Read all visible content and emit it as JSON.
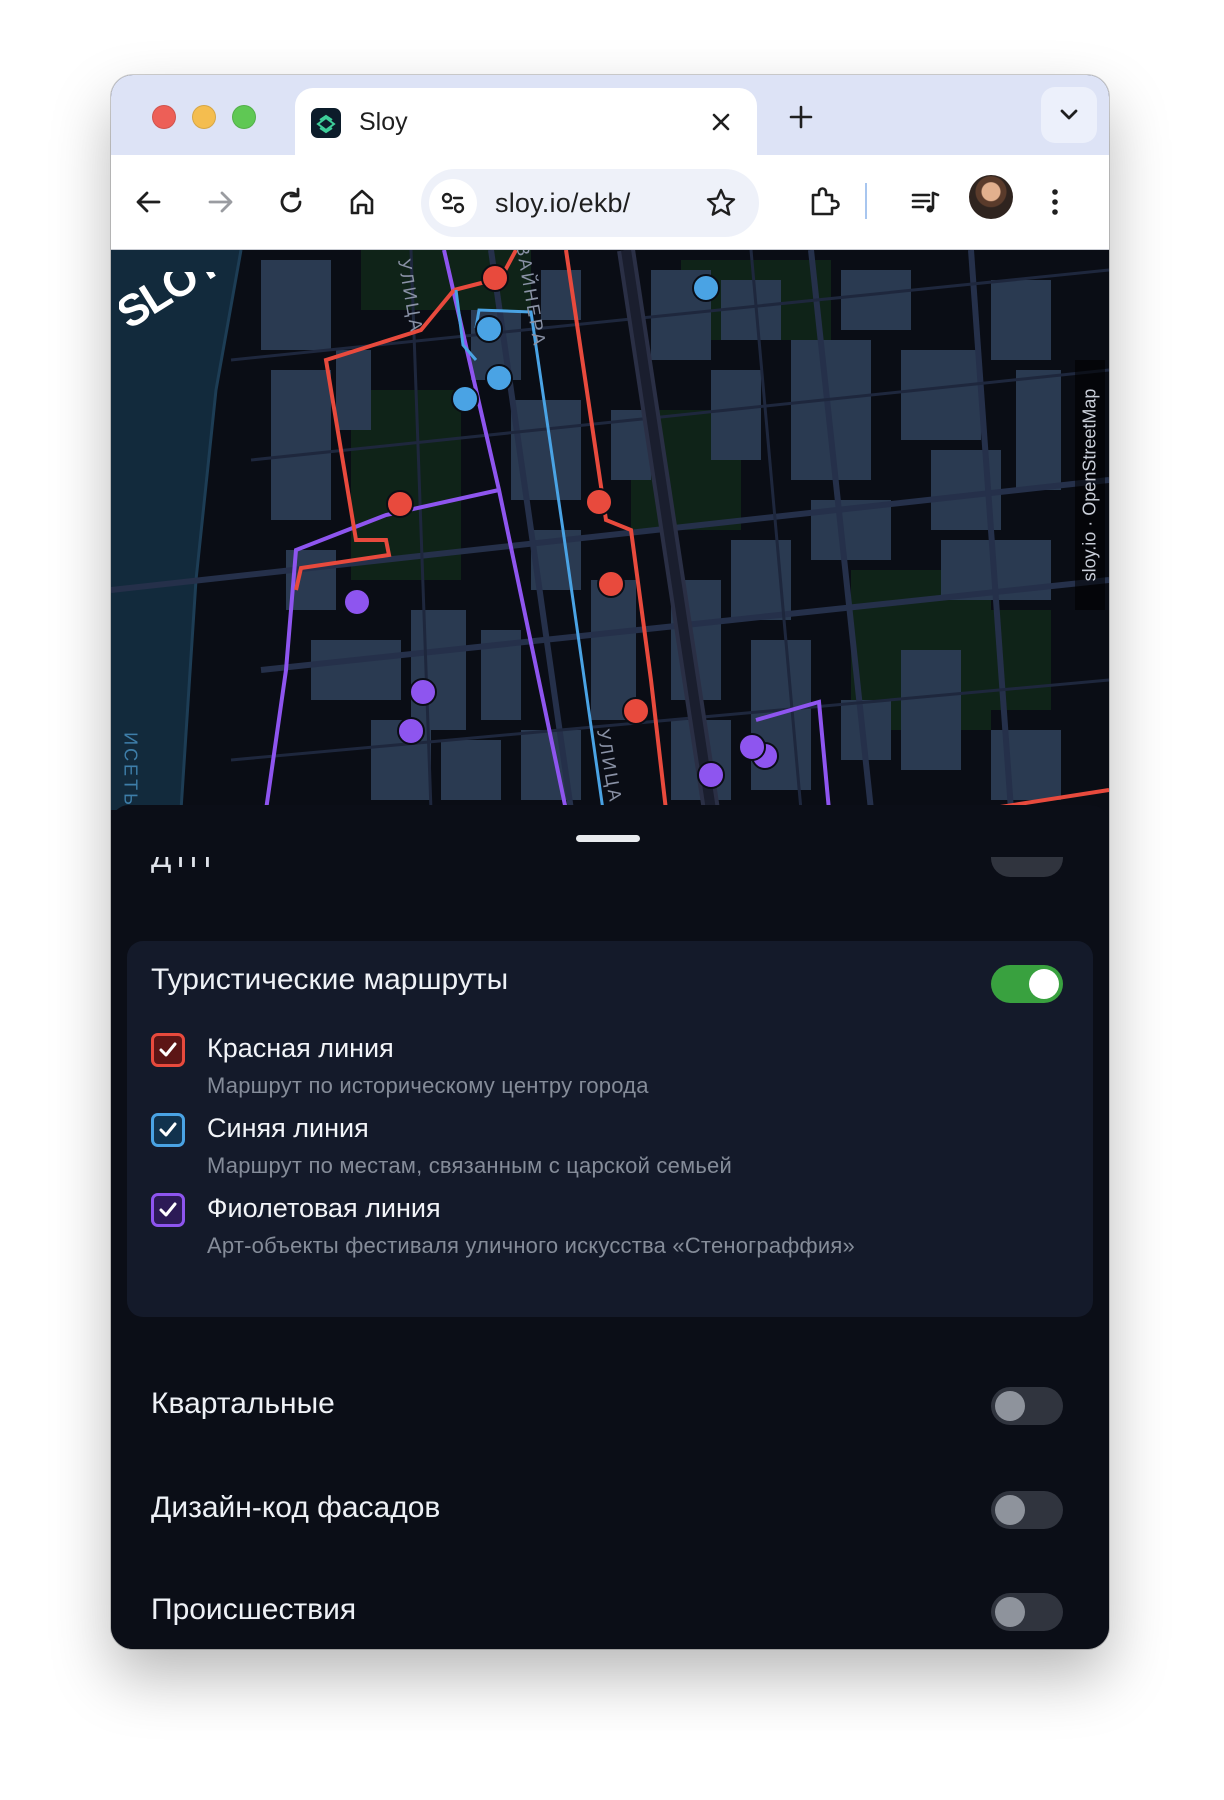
{
  "browser": {
    "tab_title": "Sloy",
    "url": "sloy.io/ekb/"
  },
  "map": {
    "street_labels": [
      "УЛИЦА",
      "ВАЙНЕРА",
      "УЛИЦА"
    ],
    "river_label": "ИСЕТЬ",
    "attribution": "sloy.io · OpenStreetMap",
    "logo_text": "SLOY"
  },
  "sheet": {
    "cut_layer": {
      "label": "ДТП",
      "enabled": false
    },
    "group": {
      "title": "Туристические маршруты",
      "enabled": true,
      "items": [
        {
          "label": "Красная линия",
          "description": "Маршрут по историческому центру города",
          "checked": true,
          "color": "#e84a3d"
        },
        {
          "label": "Синяя линия",
          "description": "Маршрут по местам, связанным с царской семьей",
          "checked": true,
          "color": "#4aa3e4"
        },
        {
          "label": "Фиолетовая линия",
          "description": "Арт-объекты фестиваля уличного искусства «Стенограффия»",
          "checked": true,
          "color": "#8e55ef"
        }
      ]
    },
    "layers": [
      {
        "label": "Квартальные",
        "enabled": false
      },
      {
        "label": "Дизайн-код фасадов",
        "enabled": false
      },
      {
        "label": "Происшествия",
        "enabled": false
      }
    ]
  }
}
